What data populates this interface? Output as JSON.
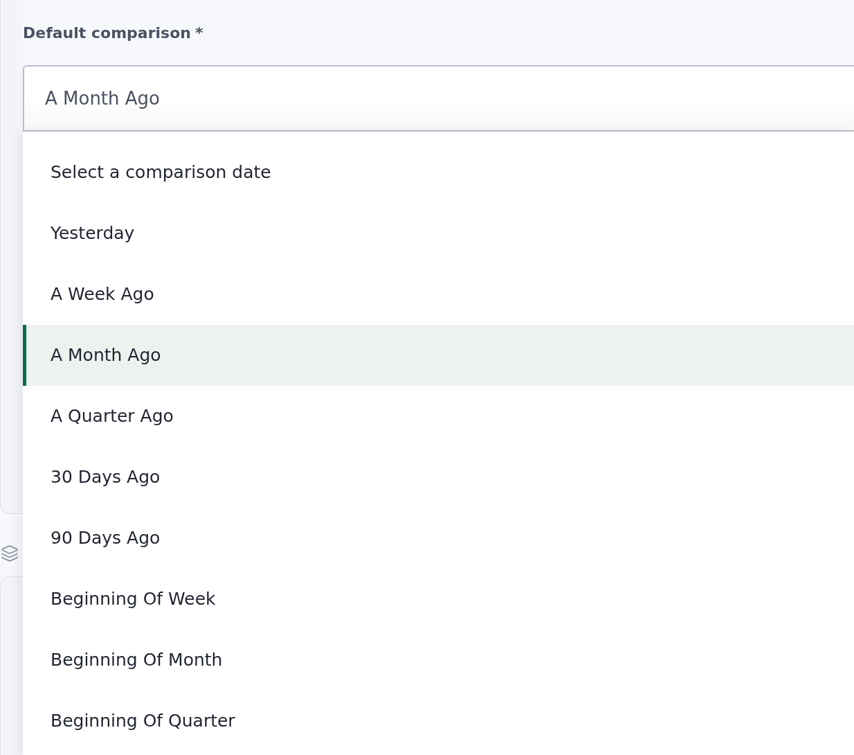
{
  "field": {
    "label": "Default comparison",
    "required_mark": "*",
    "value": "A Month Ago"
  },
  "dropdown": {
    "expanded": true,
    "options": [
      {
        "label": "Select a comparison date",
        "selected": false
      },
      {
        "label": "Yesterday",
        "selected": false
      },
      {
        "label": "A Week Ago",
        "selected": false
      },
      {
        "label": "A Month Ago",
        "selected": true
      },
      {
        "label": "A Quarter Ago",
        "selected": false
      },
      {
        "label": "30 Days Ago",
        "selected": false
      },
      {
        "label": "90 Days Ago",
        "selected": false
      },
      {
        "label": "Beginning Of Week",
        "selected": false
      },
      {
        "label": "Beginning Of Month",
        "selected": false
      },
      {
        "label": "Beginning Of Quarter",
        "selected": false
      }
    ]
  }
}
